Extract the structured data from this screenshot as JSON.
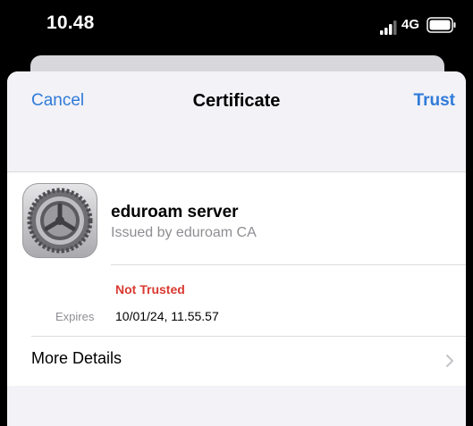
{
  "status_bar": {
    "time": "10.48",
    "network": "4G"
  },
  "nav": {
    "cancel_label": "Cancel",
    "title": "Certificate",
    "trust_label": "Trust"
  },
  "certificate": {
    "icon": "settings-gear-icon",
    "name": "eduroam server",
    "issuer": "Issued by eduroam CA",
    "trust_status": "Not Trusted",
    "trust_status_color": "#d93a30",
    "expires_label": "Expires",
    "expires_value": "10/01/24, 11.55.57"
  },
  "more_details": {
    "label": "More Details",
    "icon": "chevron-right-icon"
  },
  "colors": {
    "accent": "#2f7bd8",
    "background": "#f2f2f7"
  }
}
